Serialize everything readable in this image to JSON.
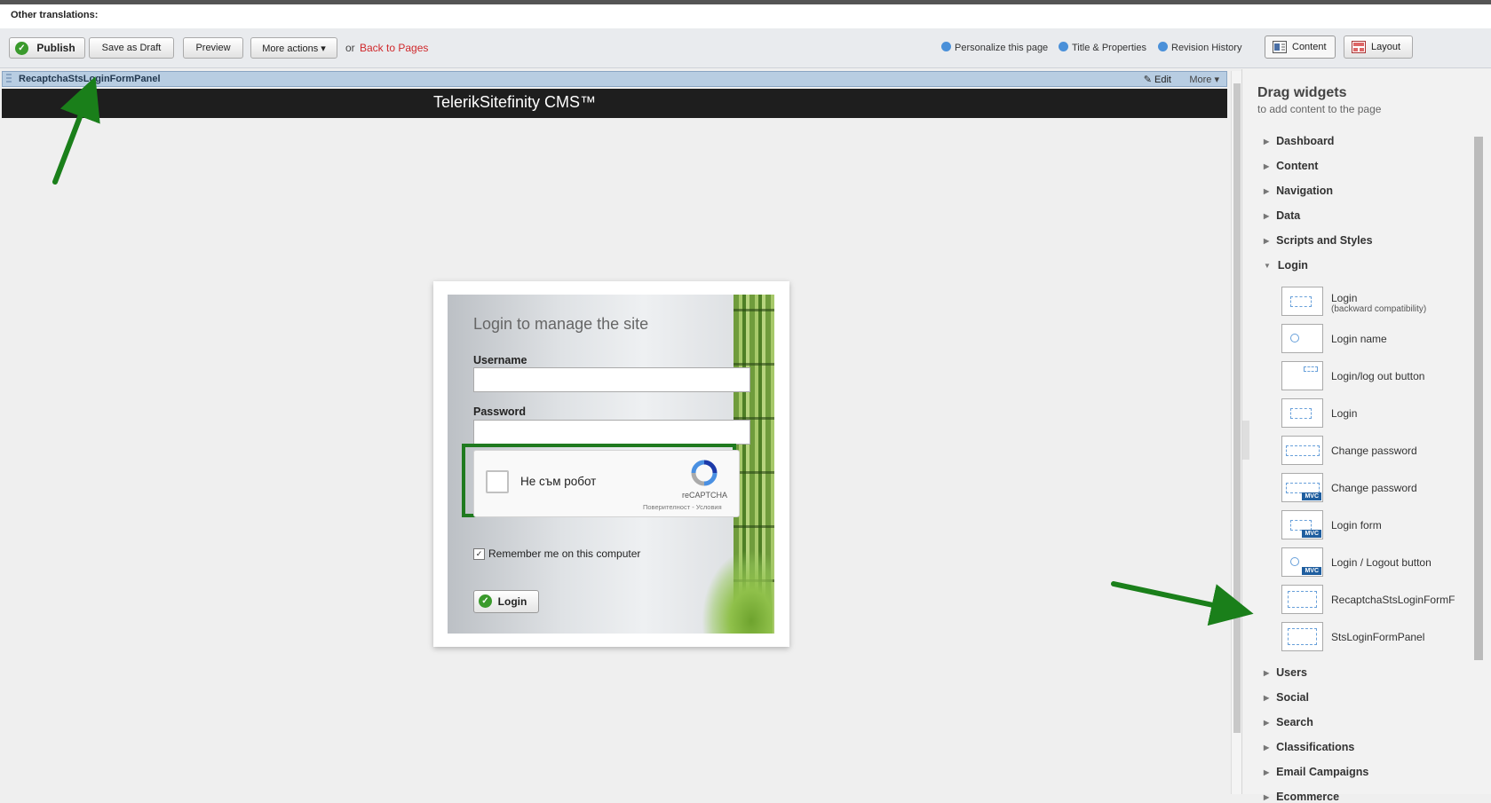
{
  "top": {
    "translations_label": "Other translations:"
  },
  "toolbar": {
    "publish": "Publish",
    "save_draft": "Save as Draft",
    "preview": "Preview",
    "more_actions": "More actions ▾",
    "or": "or",
    "back_to_pages": "Back to Pages",
    "personalize": "Personalize this page",
    "title_properties": "Title & Properties",
    "revision_history": "Revision History",
    "tab_content": "Content",
    "tab_layout": "Layout"
  },
  "panel": {
    "name": "RecaptchaStsLoginFormPanel",
    "edit": "Edit",
    "more": "More ▾"
  },
  "header": {
    "logo": "TelerikSitefinity CMS™"
  },
  "login": {
    "title": "Login to manage the site",
    "username_label": "Username",
    "password_label": "Password",
    "captcha_text": "Не съм робот",
    "captcha_brand": "reCAPTCHA",
    "captcha_terms": "Поверителност - Условия",
    "remember": "Remember me on this computer",
    "login_button": "Login"
  },
  "sidebar": {
    "title": "Drag widgets",
    "subtitle": "to add content to the page",
    "categories_top": [
      "Dashboard",
      "Content",
      "Navigation",
      "Data",
      "Scripts and Styles"
    ],
    "open_category": "Login",
    "widgets": [
      {
        "label": "Login",
        "sub": "(backward compatibility)",
        "mvc": false
      },
      {
        "label": "Login name",
        "mvc": false
      },
      {
        "label": "Login/log out button",
        "mvc": false
      },
      {
        "label": "Login",
        "mvc": false
      },
      {
        "label": "Change password",
        "mvc": false
      },
      {
        "label": "Change password",
        "mvc": true
      },
      {
        "label": "Login form",
        "mvc": true
      },
      {
        "label": "Login / Logout button",
        "mvc": true
      },
      {
        "label": "RecaptchaStsLoginFormF",
        "mvc": false
      },
      {
        "label": "StsLoginFormPanel",
        "mvc": false
      }
    ],
    "mvc_badge": "MVC",
    "categories_bottom": [
      "Users",
      "Social",
      "Search",
      "Classifications",
      "Email Campaigns",
      "Ecommerce"
    ]
  },
  "colors": {
    "accent_red": "#d0282b",
    "arrow_green": "#1a7f1a",
    "highlight_green": "#1f7a1f"
  }
}
